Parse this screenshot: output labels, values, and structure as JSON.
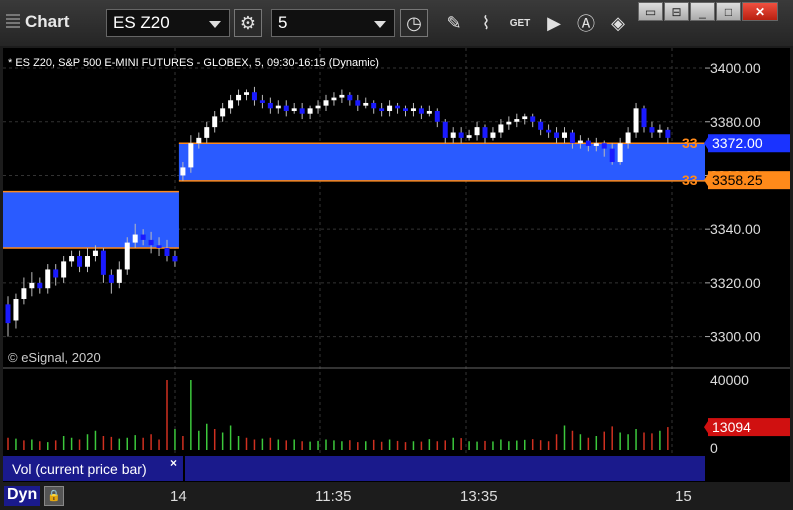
{
  "window": {
    "title": "Chart"
  },
  "toolbar": {
    "symbol": "ES Z20",
    "interval": "5",
    "icons": [
      "settings-gear-icon",
      "clock-icon",
      "pencil-icon",
      "study-icon",
      "get-icon",
      "play-icon",
      "annotation-a-icon",
      "drawing-diamond-icon"
    ]
  },
  "chart": {
    "header": "* ES Z20, S&P 500 E-MINI FUTURES - GLOBEX, 5, 09:30-16:15 (Dynamic)",
    "copyright": "© eSignal, 2020",
    "price_axis": [
      "3400.00",
      "3380.00",
      "3360.00",
      "3340.00",
      "3320.00",
      "3300.00"
    ],
    "right_labels": [
      {
        "text": "33",
        "tag": "3372.00",
        "color": "#ff8a1a",
        "tag_bg": "#1a33ff",
        "value": 3372
      },
      {
        "text": "33",
        "tag": "3358.25",
        "color": "#ff8a1a",
        "tag_bg": "#ff8a1a",
        "value": 3358.25
      }
    ],
    "time_axis": [
      "14",
      "11:35",
      "13:35",
      "15"
    ],
    "zones": [
      {
        "from_bar": 0,
        "to_bar": 21,
        "top": 3354,
        "bottom": 3333
      },
      {
        "from_bar": 22,
        "to_bar": 84,
        "top": 3372,
        "bottom": 3358
      }
    ],
    "colors": {
      "up": "#ffffff",
      "down": "#1a1aff",
      "zone": "#2a5bff",
      "zone_line": "#ff8a1a",
      "vol_up": "#3cc83c",
      "vol_down": "#d03020"
    }
  },
  "chart_data": {
    "type": "candlestick",
    "symbol": "ES Z20",
    "ylim": [
      3295,
      3403
    ],
    "candles": [
      [
        3312,
        3305,
        3315,
        3300
      ],
      [
        3306,
        3314,
        3316,
        3303
      ],
      [
        3314,
        3318,
        3322,
        3312
      ],
      [
        3318,
        3320,
        3324,
        3315
      ],
      [
        3320,
        3318,
        3322,
        3316
      ],
      [
        3318,
        3325,
        3327,
        3316
      ],
      [
        3325,
        3322,
        3327,
        3319
      ],
      [
        3322,
        3328,
        3330,
        3320
      ],
      [
        3328,
        3330,
        3332,
        3326
      ],
      [
        3330,
        3326,
        3332,
        3324
      ],
      [
        3326,
        3330,
        3333,
        3324
      ],
      [
        3330,
        3332,
        3334,
        3328
      ],
      [
        3332,
        3323,
        3333,
        3320
      ],
      [
        3323,
        3320,
        3325,
        3316
      ],
      [
        3320,
        3325,
        3328,
        3318
      ],
      [
        3325,
        3335,
        3337,
        3323
      ],
      [
        3335,
        3338,
        3342,
        3333
      ],
      [
        3338,
        3336,
        3340,
        3334
      ],
      [
        3336,
        3334,
        3339,
        3331
      ],
      [
        3334,
        3333,
        3337,
        3330
      ],
      [
        3333,
        3330,
        3336,
        3328
      ],
      [
        3330,
        3328,
        3332,
        3326
      ],
      [
        3360,
        3363,
        3365,
        3358
      ],
      [
        3363,
        3372,
        3375,
        3361
      ],
      [
        3372,
        3374,
        3376,
        3370
      ],
      [
        3374,
        3378,
        3380,
        3372
      ],
      [
        3378,
        3382,
        3384,
        3376
      ],
      [
        3382,
        3385,
        3387,
        3380
      ],
      [
        3385,
        3388,
        3390,
        3383
      ],
      [
        3388,
        3390,
        3392,
        3386
      ],
      [
        3390,
        3391,
        3392,
        3388
      ],
      [
        3391,
        3388,
        3393,
        3386
      ],
      [
        3388,
        3387,
        3390,
        3385
      ],
      [
        3387,
        3385,
        3389,
        3383
      ],
      [
        3385,
        3386,
        3388,
        3383
      ],
      [
        3386,
        3384,
        3388,
        3382
      ],
      [
        3384,
        3385,
        3387,
        3383
      ],
      [
        3385,
        3383,
        3387,
        3381
      ],
      [
        3383,
        3385,
        3386,
        3381
      ],
      [
        3385,
        3386,
        3388,
        3383
      ],
      [
        3386,
        3388,
        3390,
        3384
      ],
      [
        3388,
        3389,
        3391,
        3386
      ],
      [
        3389,
        3390,
        3392,
        3387
      ],
      [
        3390,
        3388,
        3391,
        3386
      ],
      [
        3388,
        3386,
        3390,
        3384
      ],
      [
        3386,
        3387,
        3389,
        3385
      ],
      [
        3387,
        3385,
        3388,
        3383
      ],
      [
        3385,
        3384,
        3387,
        3382
      ],
      [
        3384,
        3386,
        3388,
        3382
      ],
      [
        3386,
        3385,
        3387,
        3383
      ],
      [
        3385,
        3384,
        3386,
        3382
      ],
      [
        3384,
        3385,
        3387,
        3382
      ],
      [
        3385,
        3383,
        3386,
        3381
      ],
      [
        3383,
        3384,
        3386,
        3382
      ],
      [
        3384,
        3380,
        3385,
        3378
      ],
      [
        3380,
        3374,
        3381,
        3372
      ],
      [
        3374,
        3376,
        3378,
        3372
      ],
      [
        3376,
        3374,
        3378,
        3372
      ],
      [
        3374,
        3375,
        3377,
        3373
      ],
      [
        3375,
        3378,
        3380,
        3373
      ],
      [
        3378,
        3374,
        3379,
        3372
      ],
      [
        3374,
        3376,
        3378,
        3373
      ],
      [
        3376,
        3379,
        3381,
        3374
      ],
      [
        3379,
        3380,
        3382,
        3377
      ],
      [
        3380,
        3381,
        3383,
        3378
      ],
      [
        3381,
        3382,
        3383,
        3379
      ],
      [
        3382,
        3380,
        3383,
        3378
      ],
      [
        3380,
        3377,
        3381,
        3375
      ],
      [
        3377,
        3376,
        3379,
        3374
      ],
      [
        3376,
        3374,
        3378,
        3372
      ],
      [
        3374,
        3376,
        3378,
        3372
      ],
      [
        3376,
        3372,
        3377,
        3370
      ],
      [
        3372,
        3373,
        3375,
        3370
      ],
      [
        3373,
        3371,
        3374,
        3369
      ],
      [
        3371,
        3372,
        3374,
        3369
      ],
      [
        3372,
        3370,
        3373,
        3367
      ],
      [
        3370,
        3365,
        3372,
        3364
      ],
      [
        3365,
        3372,
        3374,
        3364
      ],
      [
        3372,
        3376,
        3378,
        3370
      ],
      [
        3376,
        3385,
        3387,
        3374
      ],
      [
        3385,
        3378,
        3386,
        3376
      ],
      [
        3378,
        3376,
        3380,
        3374
      ],
      [
        3376,
        3377,
        3379,
        3374
      ],
      [
        3377,
        3374,
        3378,
        3372
      ]
    ],
    "volume_axis": [
      "40000",
      "0"
    ],
    "volume_last": "13094",
    "volume_max": 40000,
    "volume": [
      7000,
      6500,
      5500,
      6000,
      5000,
      4500,
      5500,
      8000,
      7000,
      6000,
      9000,
      11000,
      8000,
      7500,
      6500,
      7000,
      8500,
      7000,
      9000,
      6000,
      40000,
      12000,
      8000,
      40000,
      11000,
      15000,
      12000,
      10000,
      14000,
      8000,
      7000,
      6000,
      6500,
      7000,
      6000,
      5500,
      6000,
      5000,
      4800,
      5200,
      6000,
      5500,
      5000,
      5600,
      4500,
      5000,
      5800,
      4700,
      6000,
      5200,
      4500,
      5000,
      4800,
      6200,
      5000,
      5500,
      7000,
      6800,
      5000,
      4800,
      5200,
      4900,
      6000,
      5000,
      5400,
      5800,
      6200,
      5600,
      5000,
      9000,
      14000,
      11000,
      9000,
      7000,
      8000,
      10500,
      13500,
      10000,
      9000,
      12000,
      10000,
      9500,
      11000,
      13094
    ],
    "volume_down_idx": [
      0,
      2,
      4,
      6,
      9,
      12,
      13,
      17,
      18,
      19,
      20,
      22,
      26,
      30,
      31,
      33,
      35,
      37,
      43,
      44,
      46,
      47,
      49,
      50,
      52,
      54,
      55,
      57,
      60,
      66,
      67,
      68,
      69,
      71,
      73,
      75,
      76,
      80,
      81,
      83
    ]
  },
  "study_label": "Vol (current price bar)",
  "status": {
    "dyn_label": "Dyn"
  }
}
